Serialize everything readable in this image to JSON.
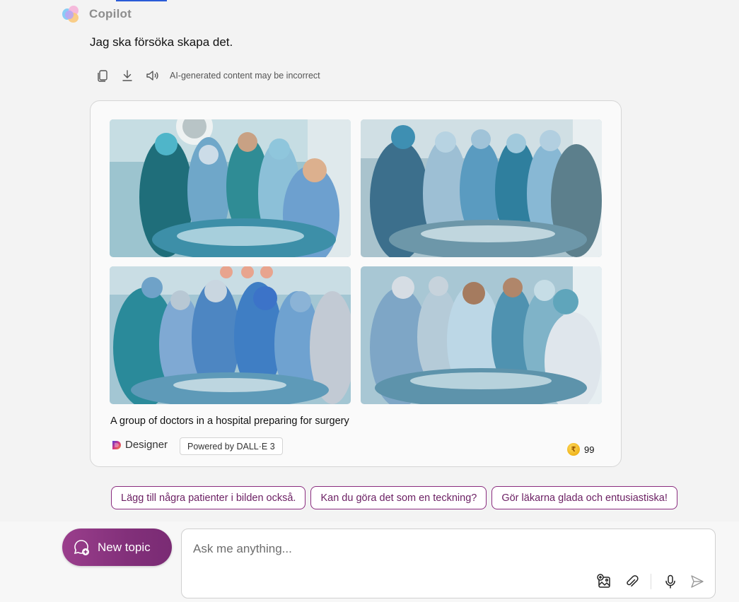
{
  "header": {
    "app_name": "Copilot"
  },
  "message": {
    "text": "Jag ska försöka skapa det."
  },
  "actions": {
    "copy_icon": "copy-icon",
    "download_icon": "download-icon",
    "speaker_icon": "speaker-icon",
    "disclaimer": "AI-generated content may be incorrect"
  },
  "image_card": {
    "caption": "A group of doctors in a hospital preparing for surgery",
    "designer_label": "Designer",
    "powered_by": "Powered by DALL·E 3",
    "boost_count": "99",
    "images": [
      {
        "description": "surgical team around operating table, image 1"
      },
      {
        "description": "surgical team around operating table, image 2"
      },
      {
        "description": "surgical team around operating table, image 3"
      },
      {
        "description": "surgical team around operating table, image 4"
      }
    ]
  },
  "suggestions": [
    "Lägg till några patienter i bilden också.",
    "Kan du göra det som en teckning?",
    "Gör läkarna glada och entusiastiska!"
  ],
  "composer": {
    "new_topic_label": "New topic",
    "placeholder": "Ask me anything...",
    "value": ""
  },
  "colors": {
    "accent": "#8a2c7f",
    "new_topic_bg": "#9a3e8c",
    "card_border": "#d6d6d6"
  }
}
